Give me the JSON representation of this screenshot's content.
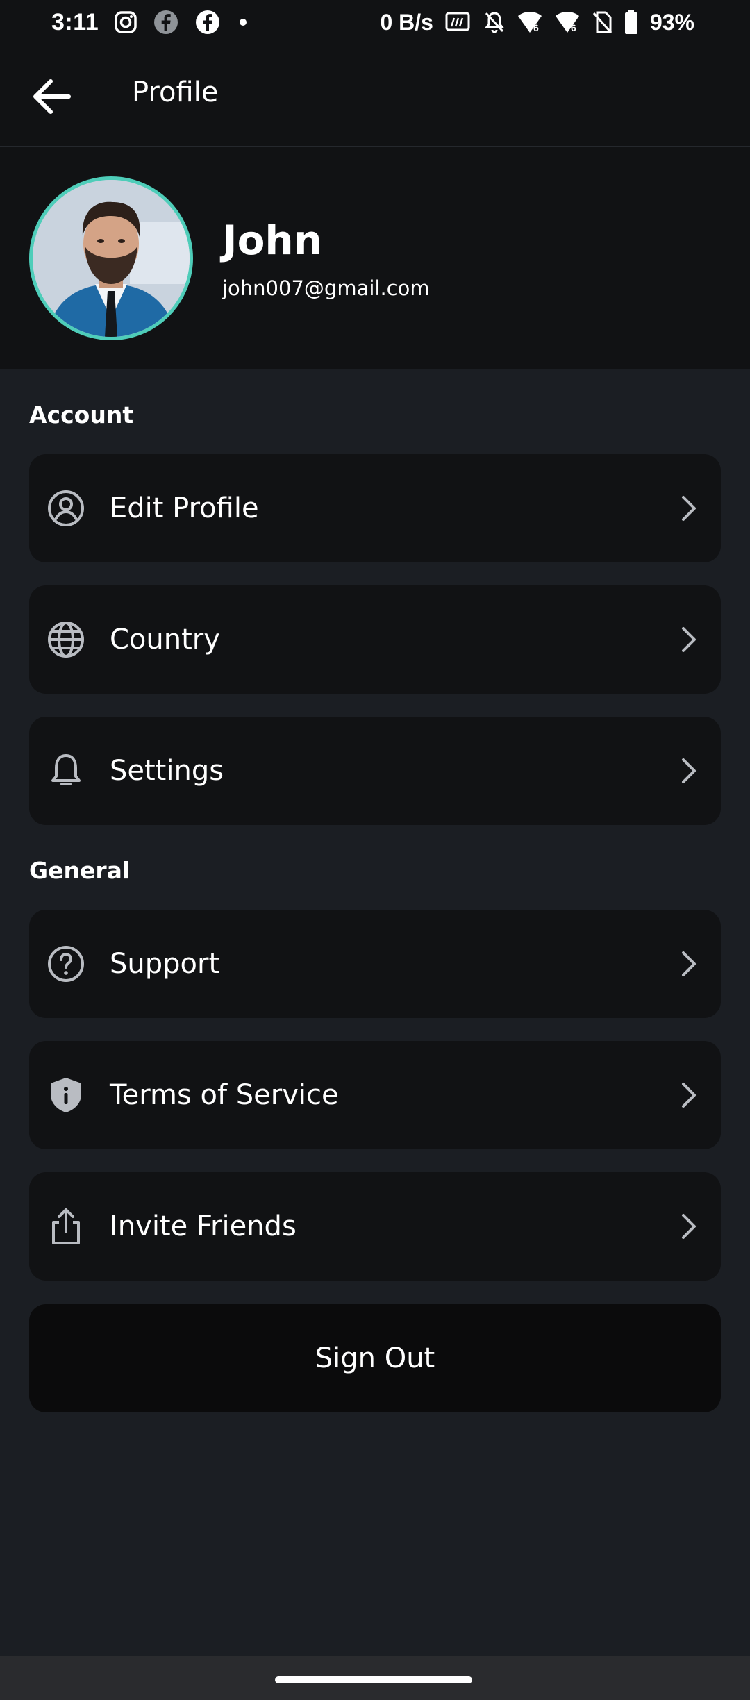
{
  "status_bar": {
    "time": "3:11",
    "network_speed": "0 B/s",
    "battery": "93%",
    "icons": [
      "instagram-icon",
      "facebook-icon",
      "facebook-icon",
      "dot-icon",
      "hz-icon",
      "bell-off-icon",
      "wifi-icon",
      "wifi-icon",
      "no-sim-icon",
      "battery-icon"
    ]
  },
  "header": {
    "title": "Profile",
    "back_icon": "arrow-left-icon"
  },
  "profile": {
    "name": "John",
    "email": "john007@gmail.com",
    "avatar_border_color": "#4ecdb9"
  },
  "sections": {
    "account": {
      "title": "Account",
      "items": [
        {
          "label": "Edit Profile",
          "icon": "user-circle-icon"
        },
        {
          "label": "Country",
          "icon": "globe-icon"
        },
        {
          "label": "Settings",
          "icon": "bell-icon"
        }
      ]
    },
    "general": {
      "title": "General",
      "items": [
        {
          "label": "Support",
          "icon": "help-circle-icon"
        },
        {
          "label": "Terms of Service",
          "icon": "shield-info-icon"
        },
        {
          "label": "Invite Friends",
          "icon": "share-icon"
        }
      ]
    }
  },
  "sign_out": {
    "label": "Sign Out"
  },
  "colors": {
    "background": "#1b1e23",
    "card": "#111214",
    "sign_out_bg": "#0b0b0c",
    "icon": "#b9bcc2",
    "accent": "#4ecdb9"
  }
}
